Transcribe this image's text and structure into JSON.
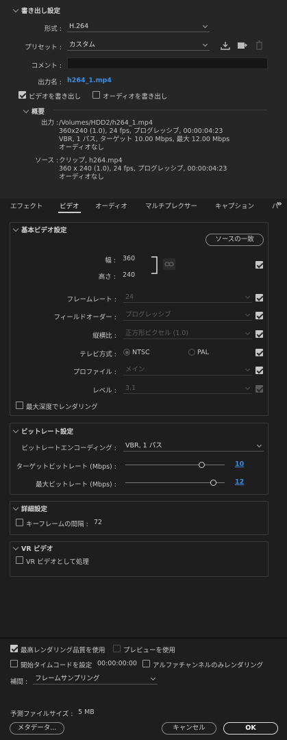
{
  "export_settings": {
    "header": "書き出し設定",
    "format_label": "形式 :",
    "format_value": "H.264",
    "preset_label": "プリセット :",
    "preset_value": "カスタム",
    "comment_label": "コメント :",
    "comment_value": "",
    "output_name_label": "出力名 :",
    "output_name_value": "h264_1.mp4",
    "export_video_label": "ビデオを書き出し",
    "export_video_checked": true,
    "export_audio_label": "オーディオを書き出し",
    "export_audio_checked": false,
    "summary_header": "概要",
    "summary": {
      "output_label": "出力 :",
      "output_lines": [
        "/Volumes/HDD2/h264_1.mp4",
        "360x240 (1.0), 24 fps, プログレッシブ, 00:00:04:23",
        "VBR, 1 パス, ターゲット 10.00 Mbps, 最大 12.00 Mbps",
        "オーディオなし"
      ],
      "source_label": "ソース :",
      "source_lines": [
        "クリップ, h264.mp4",
        "360 x 240 (1.0), 24 fps, プログレッシブ, 00:00:04:23",
        "オーディオなし"
      ]
    }
  },
  "tabs": [
    {
      "label": "エフェクト",
      "active": false
    },
    {
      "label": "ビデオ",
      "active": true
    },
    {
      "label": "オーディオ",
      "active": false
    },
    {
      "label": "マルチプレクサー",
      "active": false
    },
    {
      "label": "キャプション",
      "active": false
    },
    {
      "label": "パ",
      "active": false
    }
  ],
  "basic_video": {
    "header": "基本ビデオ設定",
    "match_source_button": "ソースの一致",
    "width_label": "幅 :",
    "width_value": "360",
    "height_label": "高さ :",
    "height_value": "240",
    "frame_rate_label": "フレームレート :",
    "frame_rate_value": "24",
    "field_order_label": "フィールドオーダー :",
    "field_order_value": "プログレッシブ",
    "aspect_label": "縦横比 :",
    "aspect_value": "正方形ピクセル (1.0)",
    "tv_standard_label": "テレビ方式 :",
    "tv_ntsc": "NTSC",
    "tv_pal": "PAL",
    "profile_label": "プロファイル :",
    "profile_value": "メイン",
    "level_label": "レベル :",
    "level_value": "3.1",
    "max_depth_label": "最大深度でレンダリング"
  },
  "bitrate": {
    "header": "ビットレート設定",
    "encoding_label": "ビットレートエンコーディング :",
    "encoding_value": "VBR, 1 パス",
    "target_label": "ターゲットビットレート (Mbps) :",
    "target_value": "10",
    "target_fraction": 0.77,
    "max_label": "最大ビットレート (Mbps) :",
    "max_value": "12",
    "max_fraction": 0.89
  },
  "advanced": {
    "header": "詳細設定",
    "keyframe_label": "キーフレームの間隔 :",
    "keyframe_value": "72"
  },
  "vr": {
    "header": "VR ビデオ",
    "process_label": "VR ビデオとして処理"
  },
  "footer": {
    "max_render_quality_label": "最高レンダリング品質を使用",
    "max_render_quality_checked": true,
    "use_previews_label": "プレビューを使用",
    "start_timecode_label": "開始タイムコードを設定",
    "start_timecode_value": "00:00:00:00",
    "alpha_only_label": "アルファチャンネルのみレンダリング",
    "interpolation_label": "補間 :",
    "interpolation_value": "フレームサンプリング",
    "estimated_size_label": "予測ファイルサイズ :",
    "estimated_size_value": "5 MB",
    "metadata_button": "メタデータ...",
    "cancel_button": "キャンセル",
    "ok_button": "OK"
  },
  "colors": {
    "accent_blue": "#3a8ce0",
    "background": "#1e1e1e",
    "panel": "#262626"
  }
}
